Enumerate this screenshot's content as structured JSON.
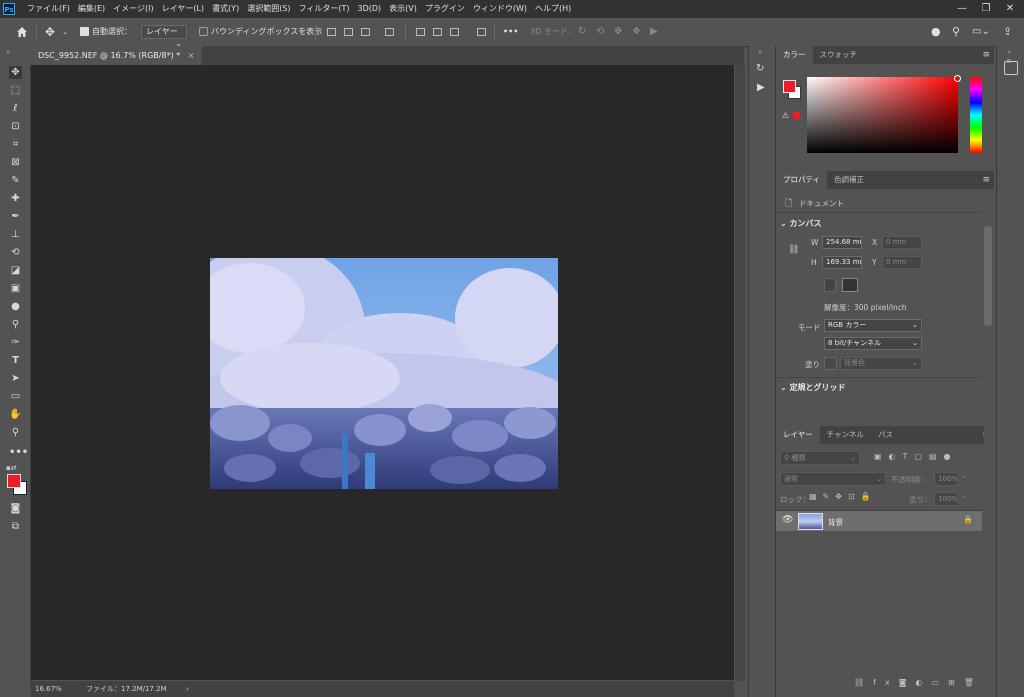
{
  "app": {
    "logo": "Ps"
  },
  "menu": [
    "ファイル(F)",
    "編集(E)",
    "イメージ(I)",
    "レイヤー(L)",
    "書式(Y)",
    "選択範囲(S)",
    "フィルター(T)",
    "3D(D)",
    "表示(V)",
    "プラグイン",
    "ウィンドウ(W)",
    "ヘルプ(H)"
  ],
  "window": {
    "minimize": "—",
    "restore": "❐",
    "close": "✕"
  },
  "options": {
    "auto_select_label": "自動選択：",
    "auto_select_target": "レイヤー",
    "bounding_box_label": "バウンディングボックスを表示",
    "more": "•••",
    "mode_3d": "3D モード："
  },
  "document": {
    "tab_title": "DSC_9952.NEF @ 16.7% (RGB/8*) *",
    "tab_close": "×"
  },
  "status": {
    "zoom": "16.67%",
    "file_info": "ファイル：17.2M/17.2M",
    "arrow": "›"
  },
  "color_panel": {
    "tabs": [
      "カラー",
      "スウォッチ"
    ],
    "foreground": "#ee1c24",
    "background": "#ffffff"
  },
  "properties_panel": {
    "tabs": [
      "プロパティ",
      "色調補正"
    ],
    "doc_label": "ドキュメント",
    "canvas_section": "カンバス",
    "w_label": "W",
    "w_value": "254.68 mm",
    "h_label": "H",
    "h_value": "169.33 mm",
    "x_label": "X",
    "x_value": "0 mm",
    "y_label": "Y",
    "y_value": "0 mm",
    "resolution": "解像度：300 pixel/inch",
    "mode_label": "モード",
    "mode_value": "RGB カラー",
    "bit_value": "8 bit/チャンネル",
    "fill_label": "塗り",
    "fill_value": "背景色",
    "guides_section": "定規とグリッド"
  },
  "layers_panel": {
    "tabs": [
      "レイヤー",
      "チャンネル",
      "パス"
    ],
    "filter_kind": "種類",
    "blend_mode": "通常",
    "opacity_label": "不透明度：",
    "opacity_value": "100%",
    "lock_label": "ロック：",
    "fill_label": "塗り：",
    "fill_value": "100%",
    "layers": [
      {
        "name": "背景",
        "visible": true,
        "locked": true
      }
    ],
    "footer_icons": [
      "link-icon",
      "fx-icon",
      "mask-icon",
      "adjustment-icon",
      "group-icon",
      "new-layer-icon",
      "trash-icon"
    ]
  },
  "toolbar_tools": [
    "move-tool",
    "marquee-tool",
    "lasso-tool",
    "object-select-tool",
    "crop-tool",
    "frame-tool",
    "eyedropper-tool",
    "healing-tool",
    "brush-tool",
    "stamp-tool",
    "history-brush-tool",
    "eraser-tool",
    "gradient-tool",
    "blur-tool",
    "dodge-tool",
    "pen-tool",
    "type-tool",
    "path-select-tool",
    "rectangle-tool",
    "hand-tool",
    "zoom-tool",
    "edit-toolbar"
  ]
}
